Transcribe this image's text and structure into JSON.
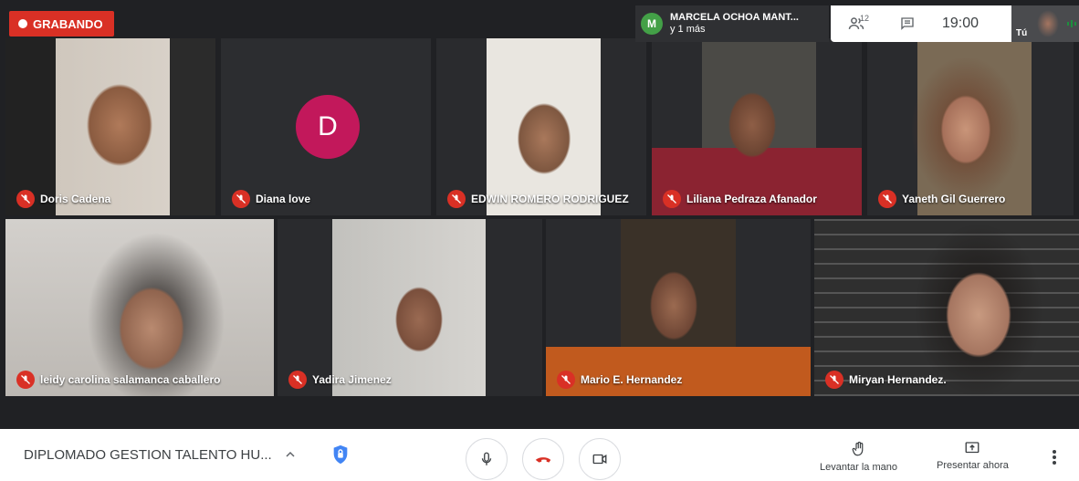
{
  "recording": {
    "label": "GRABANDO"
  },
  "active_speaker": {
    "initial": "M",
    "name": "MARCELA OCHOA MANT...",
    "more": "y 1 más"
  },
  "top_controls": {
    "people_count": "12",
    "time": "19:00",
    "self_label": "Tú"
  },
  "participants": [
    {
      "name": "Doris Cadena"
    },
    {
      "name": "Diana love",
      "avatar_initial": "D"
    },
    {
      "name": "EDWIN ROMERO RODRIGUEZ"
    },
    {
      "name": "Liliana Pedraza Afanador"
    },
    {
      "name": "Yaneth Gil Guerrero"
    },
    {
      "name": "leidy carolina salamanca caballero"
    },
    {
      "name": "Yadira Jimenez"
    },
    {
      "name": "Mario E. Hernandez"
    },
    {
      "name": "Miryan Hernandez."
    }
  ],
  "bottom": {
    "meeting_title": "DIPLOMADO GESTION TALENTO HU...",
    "raise_hand_label": "Levantar la mano",
    "present_label": "Presentar ahora"
  },
  "colors": {
    "record": "#d93025",
    "avatar_d": "#c2185b",
    "speaker_avatar": "#43a047",
    "end_call": "#d93025"
  },
  "icons": [
    "record-dot-icon",
    "people-icon",
    "chat-icon",
    "mic-muted-icon",
    "chevron-up-icon",
    "shield-icon",
    "mic-icon",
    "end-call-icon",
    "camera-icon",
    "hand-icon",
    "present-icon",
    "more-icon"
  ]
}
